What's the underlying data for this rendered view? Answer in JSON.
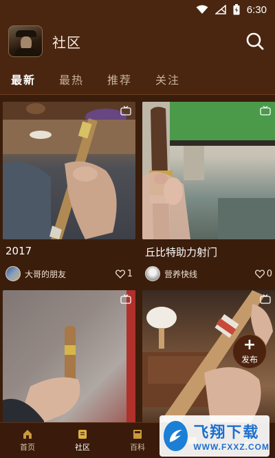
{
  "status_bar": {
    "time": "6:30"
  },
  "header": {
    "title": "社区"
  },
  "tabs": [
    {
      "label": "最新",
      "active": true
    },
    {
      "label": "最热",
      "active": false
    },
    {
      "label": "推荐",
      "active": false
    },
    {
      "label": "关注",
      "active": false
    }
  ],
  "posts": [
    {
      "title": "2017",
      "user": "大哥的朋友",
      "likes": "1"
    },
    {
      "title": "丘比特助力射门",
      "user": "营养快线",
      "likes": "0"
    },
    {
      "title": "",
      "user": "",
      "likes": ""
    },
    {
      "title": "",
      "user": "",
      "likes": ""
    }
  ],
  "fab": {
    "plus": "+",
    "label": "发布"
  },
  "bottom_nav": [
    {
      "label": "首页",
      "icon": "home-icon"
    },
    {
      "label": "社区",
      "icon": "community-icon"
    },
    {
      "label": "百科",
      "icon": "encyclopedia-icon"
    },
    {
      "label": "",
      "icon": "shop-icon"
    },
    {
      "label": "",
      "icon": "profile-icon"
    }
  ],
  "watermark": {
    "main": "飞翔下载",
    "sub": "WWW.FXXZ.COM"
  },
  "colors": {
    "background": "#3b1d0c",
    "header": "#4a2610",
    "accent": "#ffffff"
  }
}
